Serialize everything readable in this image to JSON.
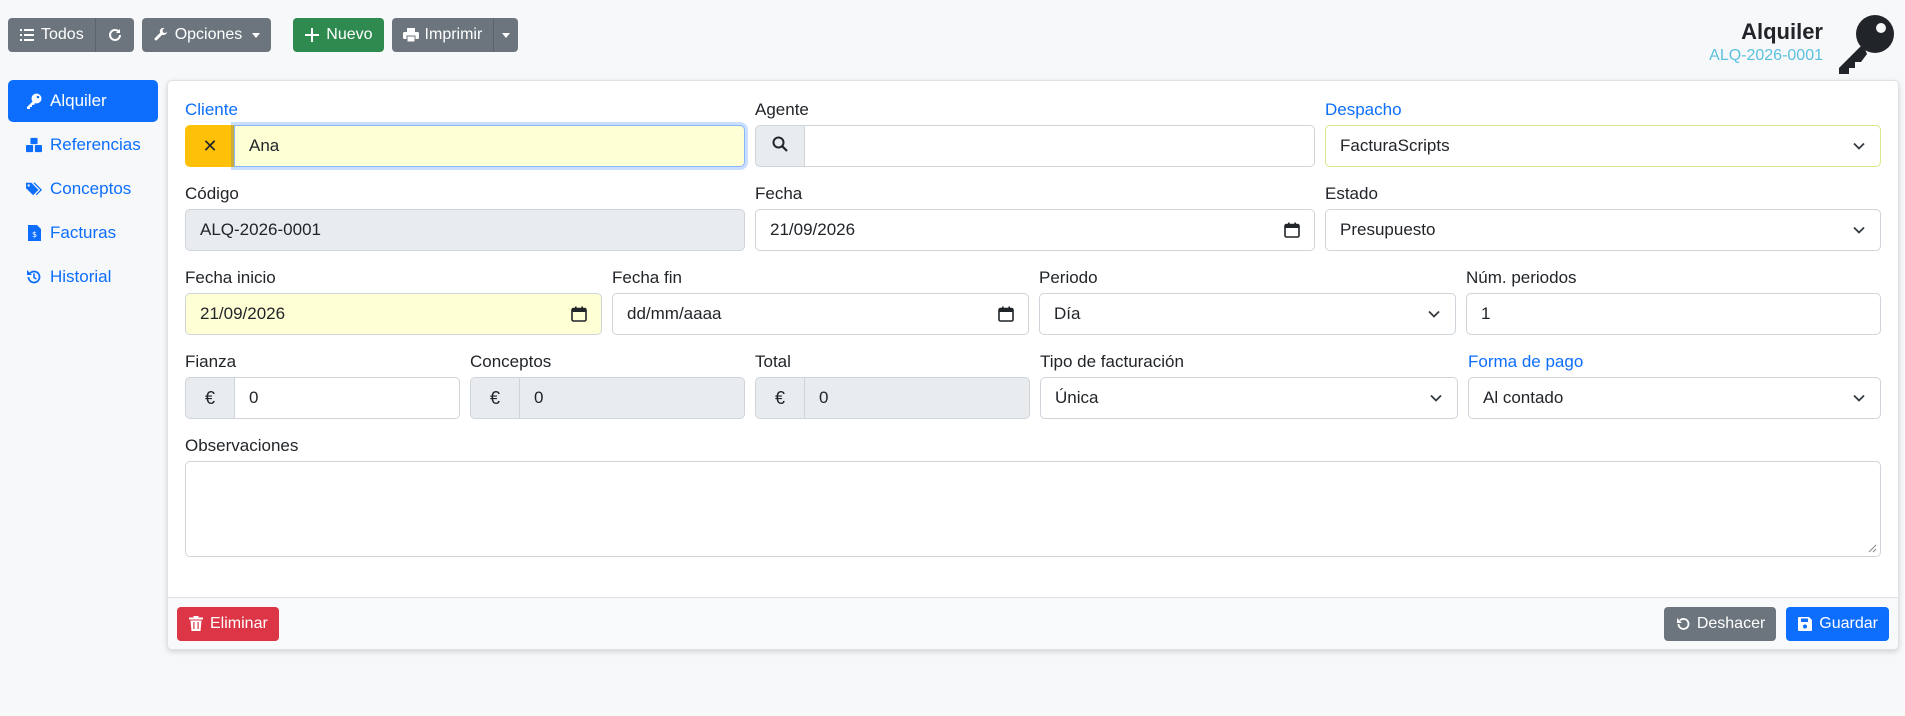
{
  "toolbar": {
    "todos": "Todos",
    "opciones": "Opciones",
    "nuevo": "Nuevo",
    "imprimir": "Imprimir"
  },
  "header": {
    "title": "Alquiler",
    "code": "ALQ-2026-0001"
  },
  "sidebar": {
    "items": [
      {
        "label": "Alquiler",
        "icon": "key-icon"
      },
      {
        "label": "Referencias",
        "icon": "cubes-icon"
      },
      {
        "label": "Conceptos",
        "icon": "tags-icon"
      },
      {
        "label": "Facturas",
        "icon": "invoice-icon"
      },
      {
        "label": "Historial",
        "icon": "history-icon"
      }
    ]
  },
  "form": {
    "cliente": {
      "label": "Cliente",
      "value": "Ana"
    },
    "agente": {
      "label": "Agente",
      "value": ""
    },
    "despacho": {
      "label": "Despacho",
      "value": "FacturaScripts"
    },
    "codigo": {
      "label": "Código",
      "value": "ALQ-2026-0001"
    },
    "fecha": {
      "label": "Fecha",
      "value": "21/09/2026"
    },
    "estado": {
      "label": "Estado",
      "value": "Presupuesto"
    },
    "fecha_inicio": {
      "label": "Fecha inicio",
      "value": "21/09/2026"
    },
    "fecha_fin": {
      "label": "Fecha fin",
      "value": "dd/mm/aaaa"
    },
    "periodo": {
      "label": "Periodo",
      "value": "Día"
    },
    "num_periodos": {
      "label": "Núm. periodos",
      "value": "1"
    },
    "fianza": {
      "label": "Fianza",
      "value": "0",
      "currency": "€"
    },
    "conceptos": {
      "label": "Conceptos",
      "value": "0",
      "currency": "€"
    },
    "total": {
      "label": "Total",
      "value": "0",
      "currency": "€"
    },
    "tipo_facturacion": {
      "label": "Tipo de facturación",
      "value": "Única"
    },
    "forma_pago": {
      "label": "Forma de pago",
      "value": "Al contado"
    },
    "observaciones": {
      "label": "Observaciones",
      "value": ""
    }
  },
  "footer": {
    "eliminar": "Eliminar",
    "deshacer": "Deshacer",
    "guardar": "Guardar"
  },
  "colors": {
    "primary": "#0d6efd",
    "secondary": "#6c757d",
    "success": "#2f8a4f",
    "danger": "#dc3545",
    "warning": "#ffc107",
    "info": "#5bc0de"
  }
}
